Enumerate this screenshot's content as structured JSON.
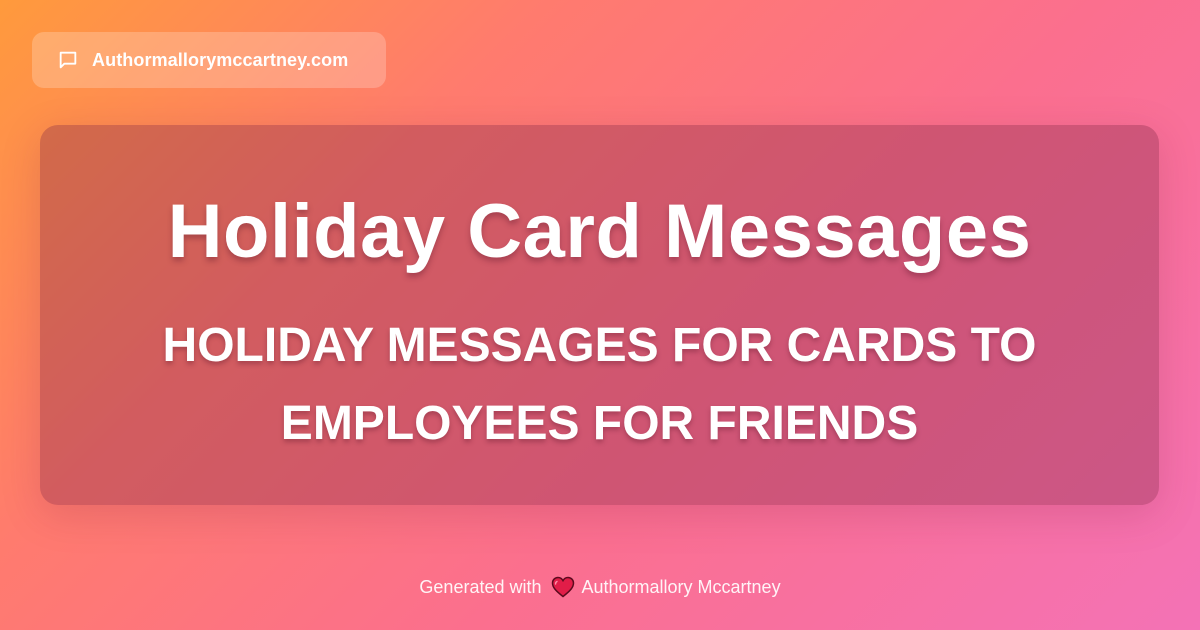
{
  "site_badge": {
    "icon": "chat-bubble-icon",
    "label": "Authormallorymccartney.com"
  },
  "card": {
    "title": "Holiday Card Messages",
    "subtitle": "HOLIDAY MESSAGES FOR CARDS TO EMPLOYEES FOR FRIENDS"
  },
  "footer": {
    "prefix": "Generated with",
    "icon": "heart-icon",
    "author": "Authormallory Mccartney"
  },
  "colors": {
    "gradient_start": "#ff9a3c",
    "gradient_end": "#f472b6",
    "heart": "#e11d48",
    "text": "#ffffff"
  }
}
